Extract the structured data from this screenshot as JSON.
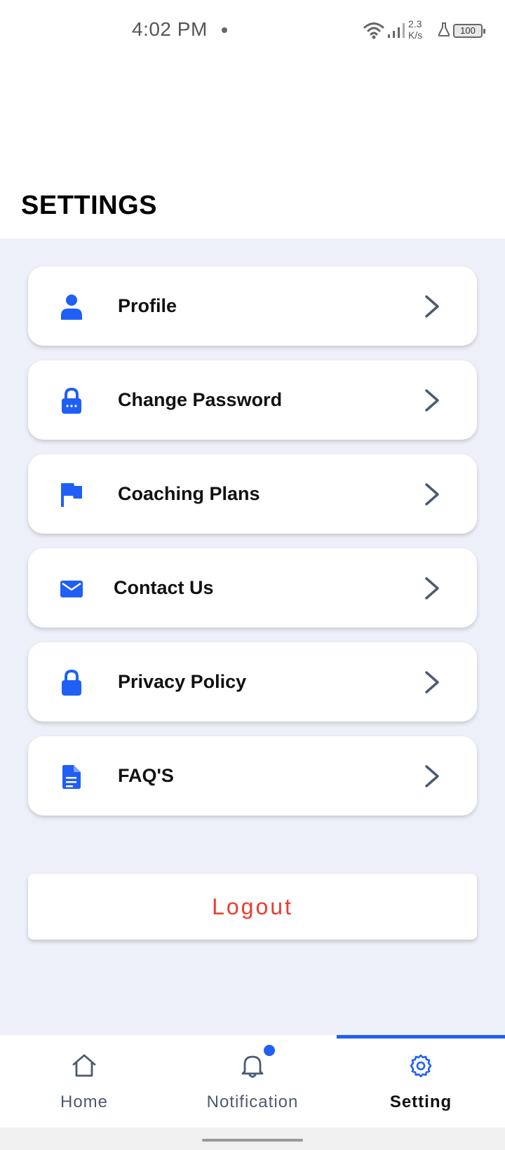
{
  "status_bar": {
    "time": "4:02 PM",
    "speed_value": "2.3",
    "speed_unit": "K/s",
    "battery": "100"
  },
  "header": {
    "title": "SETTINGS"
  },
  "menu": {
    "items": [
      {
        "label": "Profile",
        "icon": "person-icon"
      },
      {
        "label": "Change Password",
        "icon": "password-lock-icon"
      },
      {
        "label": "Coaching Plans",
        "icon": "flag-icon"
      },
      {
        "label": "Contact Us",
        "icon": "mail-icon"
      },
      {
        "label": "Privacy Policy",
        "icon": "lock-icon"
      },
      {
        "label": "FAQ'S",
        "icon": "document-icon"
      }
    ]
  },
  "logout": {
    "label": "Logout"
  },
  "bottom_nav": {
    "items": [
      {
        "label": "Home",
        "icon": "home-icon",
        "active": false
      },
      {
        "label": "Notification",
        "icon": "bell-icon",
        "active": false,
        "badge": true
      },
      {
        "label": "Setting",
        "icon": "gear-icon",
        "active": true
      }
    ]
  },
  "colors": {
    "accent": "#1f5ff5",
    "logout": "#f03a2e",
    "background": "#edf0f8",
    "nav_text": "#4c5a72"
  }
}
